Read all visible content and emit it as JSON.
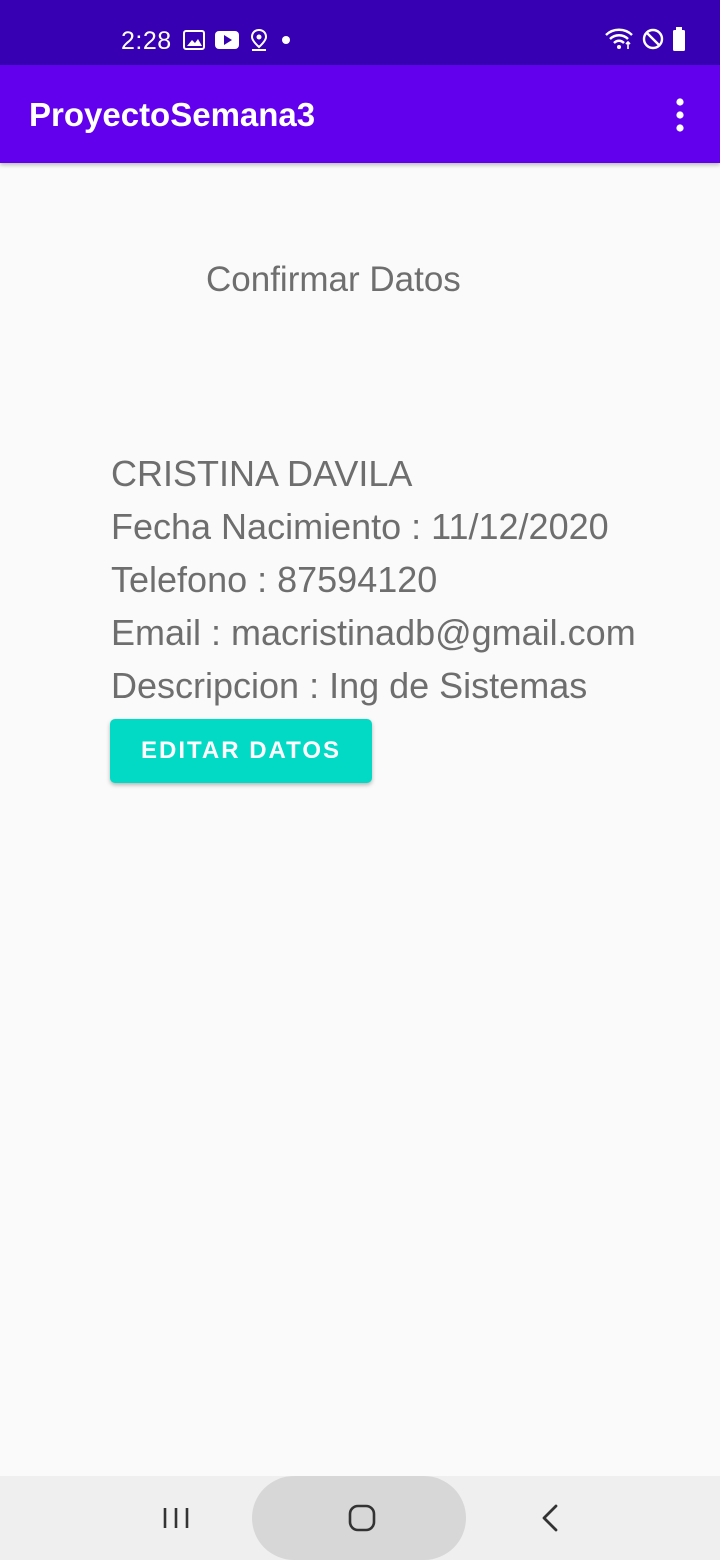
{
  "status_bar": {
    "time": "2:28",
    "left_icons": [
      "image-icon",
      "youtube-icon",
      "location-icon",
      "dot-icon"
    ],
    "right_icons": [
      "wifi-icon",
      "do-not-disturb-icon",
      "battery-icon"
    ]
  },
  "app_bar": {
    "title": "ProyectoSemana3",
    "menu_icon": "overflow-menu-icon"
  },
  "main": {
    "heading": "Confirmar Datos",
    "name": "CRISTINA DAVILA",
    "birth_date": "Fecha Nacimiento : 11/12/2020",
    "phone": "Telefono : 87594120",
    "email": "Email : macristinadb@gmail.com",
    "description": "Descripcion : Ing de Sistemas",
    "edit_button_label": "EDITAR DATOS"
  },
  "nav_bar": {
    "icons": [
      "recent-apps-icon",
      "home-icon",
      "back-icon"
    ]
  },
  "colors": {
    "status_bar": "#3700b3",
    "app_bar": "#6200ee",
    "accent_button": "#03dac5",
    "text_secondary": "#6e6e6e",
    "background": "#fafafa"
  }
}
